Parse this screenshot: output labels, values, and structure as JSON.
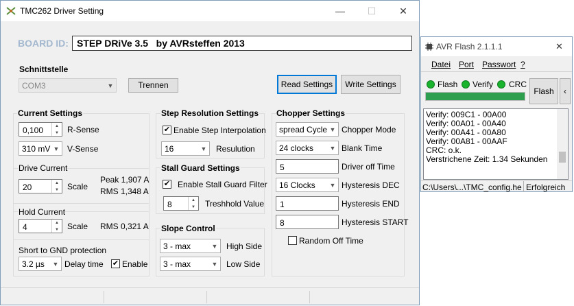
{
  "tmc_window": {
    "title": "TMC262 Driver Setting",
    "board_id_label": "BOARD ID:",
    "board_id_value": "STEP DRiVe 3.5   by AVRsteffen 2013",
    "interface": {
      "title": "Schnittstelle",
      "port": "COM3",
      "disconnect_label": "Trennen"
    },
    "read_settings_label": "Read Settings",
    "write_settings_label": "Write Settings",
    "current_settings": {
      "title": "Current Settings",
      "rsense_value": "0,100",
      "rsense_label": "R-Sense",
      "vsense_value": "310 mV",
      "vsense_label": "V-Sense",
      "drive_current_label": "Drive Current",
      "drive_value": "20",
      "drive_scale_label": "Scale",
      "peak_text": "Peak 1,907 A",
      "rms_text": "RMS 1,348 A",
      "hold_current_label": "Hold Current",
      "hold_value": "4",
      "hold_scale_label": "Scale",
      "hold_rms_text": "RMS 0,321 A",
      "short_label": "Short to GND protection",
      "delay_value": "3.2 µs",
      "delay_label": "Delay time",
      "enable_label": "Enable"
    },
    "step_resolution": {
      "title": "Step Resolution Settings",
      "interpolation_label": "Enable Step Interpolation",
      "resolution_value": "16",
      "resolution_label": "Resulution"
    },
    "stall_guard": {
      "title": "Stall Guard Settings",
      "enable_label": "Enable Stall Guard Filter",
      "threshold_value": "8",
      "threshold_label": "Treshhold Value"
    },
    "slope_control": {
      "title": "Slope Control",
      "high_value": "3 - max",
      "high_label": "High Side",
      "low_value": "3 - max",
      "low_label": "Low Side"
    },
    "chopper": {
      "title": "Chopper Settings",
      "mode_value": "spread Cycle",
      "mode_label": "Chopper Mode",
      "blank_value": "24 clocks",
      "blank_label": "Blank Time",
      "offtime_value": "5",
      "offtime_label": "Driver off Time",
      "hdec_value": "16 Clocks",
      "hdec_label": "Hysteresis DEC",
      "hend_value": "1",
      "hend_label": "Hysteresis END",
      "hstart_value": "8",
      "hstart_label": "Hysteresis START",
      "random_label": "Random Off Time"
    }
  },
  "avr_window": {
    "title": "AVR Flash 2.1.1.1",
    "menu": [
      "Datei",
      "Port",
      "Passwort",
      "?"
    ],
    "led_flash": "Flash",
    "led_verify": "Verify",
    "led_crc": "CRC",
    "flash_button": "Flash",
    "progress": 1.0,
    "log": [
      "Verify: 009C1 - 00A00",
      "Verify: 00A01 - 00A40",
      "Verify: 00A41 - 00A80",
      "Verify: 00A81 - 00AAF",
      "CRC: o.k.",
      "Verstrichene Zeit: 1.34 Sekunden"
    ],
    "status_path": "C:\\Users\\...\\TMC_config.he",
    "status_result": "Erfolgreich"
  },
  "colors": {
    "accent": "#0078d7",
    "led_green": "#19b32e",
    "progress_green": "#2e9e4f",
    "board_label": "#a3b8cf"
  }
}
